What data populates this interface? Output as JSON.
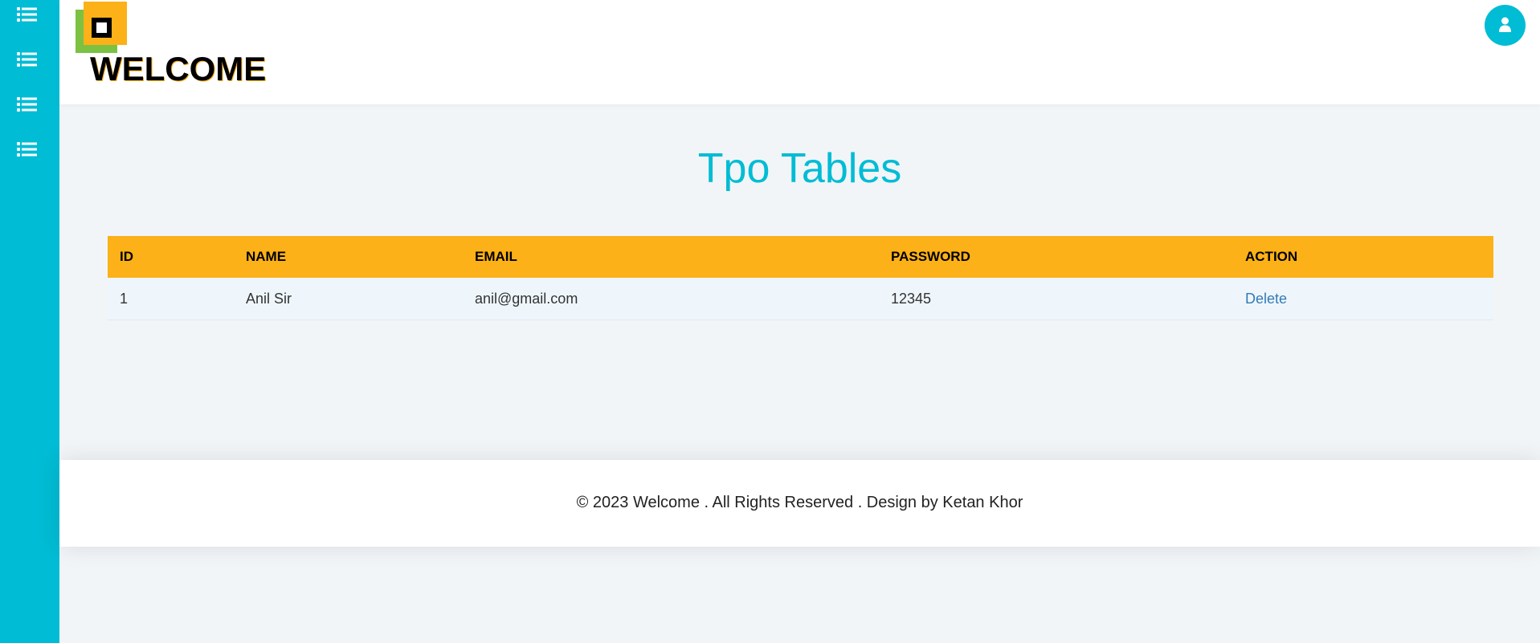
{
  "sidebar": {
    "items": [
      {
        "icon": "list-icon"
      },
      {
        "icon": "list-icon"
      },
      {
        "icon": "list-icon"
      },
      {
        "icon": "list-icon"
      }
    ],
    "color": "#00bcd4"
  },
  "header": {
    "brand": "WELCOME",
    "logo_icon": "logo-icon",
    "avatar_icon": "user-icon"
  },
  "main": {
    "title": "Tpo Tables",
    "table": {
      "headers": [
        "ID",
        "NAME",
        "EMAIL",
        "PASSWORD",
        "ACTION"
      ],
      "rows": [
        {
          "id": "1",
          "name": "Anil Sir",
          "email": "anil@gmail.com",
          "password": "12345",
          "action": "Delete"
        }
      ]
    }
  },
  "footer": {
    "text": "© 2023 Welcome . All Rights Reserved . Design by Ketan Khor"
  },
  "colors": {
    "accent": "#00bcd4",
    "table_header": "#fbb117",
    "logo_green": "#7cc142",
    "link": "#337ab7"
  }
}
